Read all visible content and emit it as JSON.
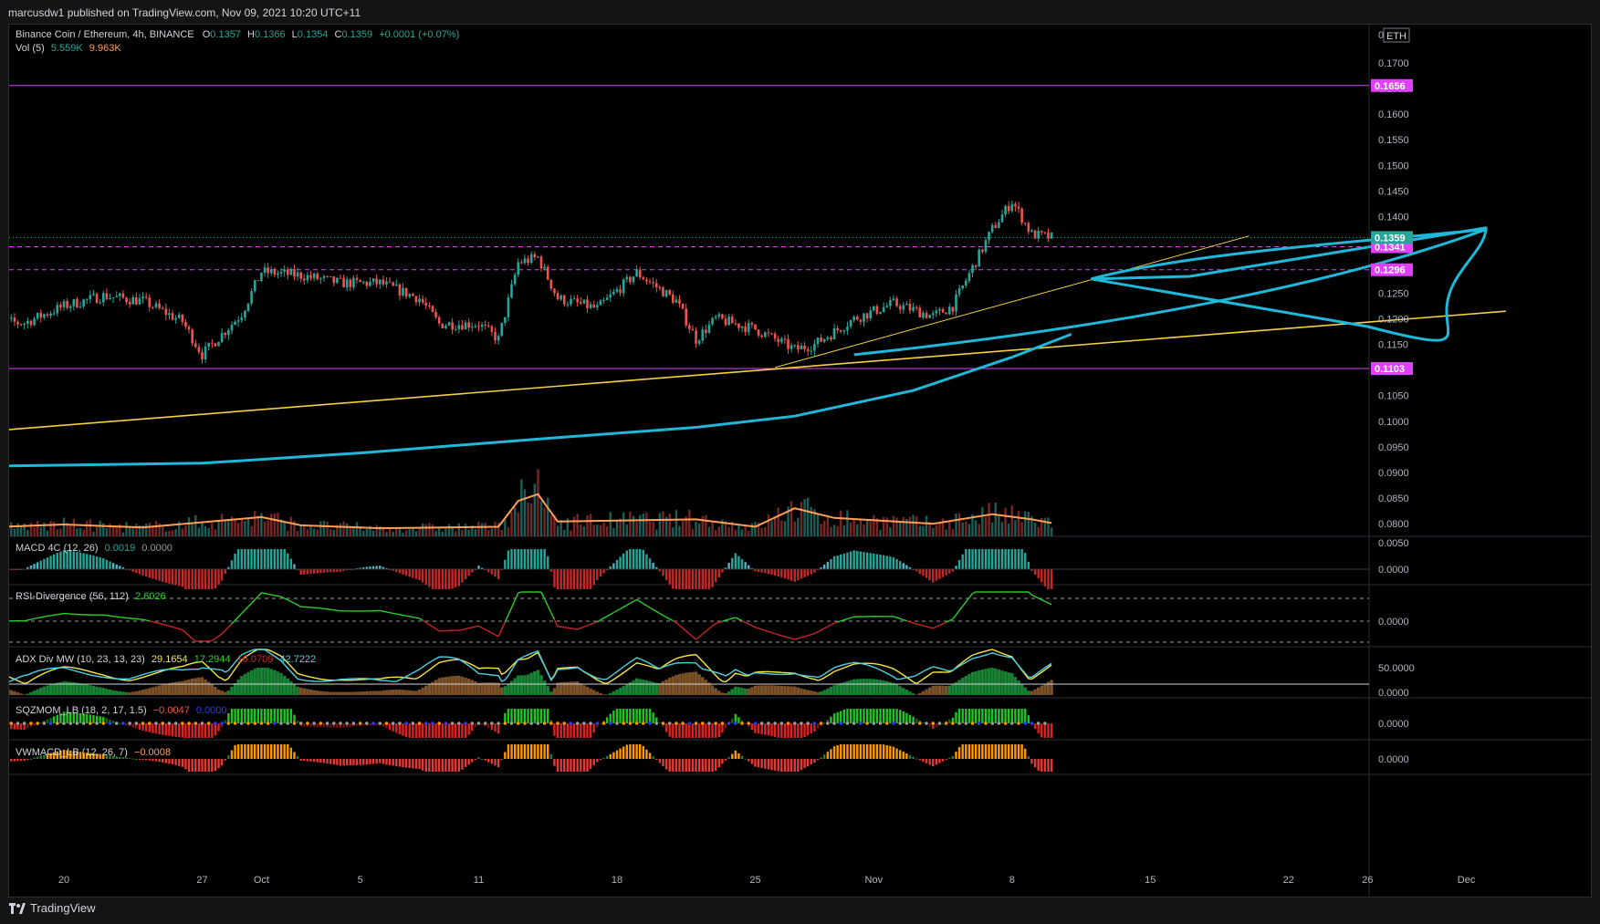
{
  "header": {
    "published": "marcusdw1 published on TradingView.com, Nov 09, 2021 10:20 UTC+11",
    "brand": "TradingView"
  },
  "legend": {
    "symbol": "Binance Coin / Ethereum, 4h, BINANCE",
    "o_label": "O",
    "o": "0.1357",
    "h_label": "H",
    "h": "0.1366",
    "l_label": "L",
    "l": "0.1354",
    "c_label": "C",
    "c": "0.1359",
    "change": "+0.0001 (+0.07%)",
    "vol_label": "Vol (5)",
    "vol1": "5.559K",
    "vol2": "9.963K"
  },
  "currency": "ETH",
  "colors": {
    "up": "#26a69a",
    "down": "#ef5350",
    "purple": "#e040fb",
    "yellow": "#f5d142",
    "cyan": "#1fb8d8",
    "orange": "#ff9f57",
    "green": "#2bd12b",
    "red": "#c62828",
    "price_tag": "#26a69a"
  },
  "chart_data": [
    {
      "type": "candlestick",
      "title": "Binance Coin / Ethereum, 4h, BINANCE",
      "ylim": [
        0.0775,
        0.1775
      ],
      "y_ticks": [
        "0.1700",
        "0.1650",
        "0.1600",
        "0.1550",
        "0.1500",
        "0.1450",
        "0.1400",
        "0.1350",
        "0.1300",
        "0.1250",
        "0.1200",
        "0.1150",
        "0.1100",
        "0.1050",
        "0.1000",
        "0.0950",
        "0.0900",
        "0.0850",
        "0.0800"
      ],
      "top_tick": "0",
      "x_ticks": [
        "20",
        "27",
        "Oct",
        "5",
        "11",
        "18",
        "25",
        "Nov",
        "8",
        "15",
        "22",
        "26",
        "Dec"
      ],
      "close_path": [
        [
          "Sep 16",
          0.1195
        ],
        [
          "Sep 18",
          0.1192
        ],
        [
          "Sep 20",
          0.1225
        ],
        [
          "Sep 22",
          0.1245
        ],
        [
          "Sep 24",
          0.1235
        ],
        [
          "Sep 26",
          0.1195
        ],
        [
          "Sep 27",
          0.113
        ],
        [
          "Sep 29",
          0.121
        ],
        [
          "Sep 30",
          0.1292
        ],
        [
          "Oct 2",
          0.1285
        ],
        [
          "Oct 4",
          0.127
        ],
        [
          "Oct 6",
          0.127
        ],
        [
          "Oct 8",
          0.124
        ],
        [
          "Oct 9",
          0.119
        ],
        [
          "Oct 11",
          0.119
        ],
        [
          "Oct 12",
          0.116
        ],
        [
          "Oct 13",
          0.131
        ],
        [
          "Oct 14",
          0.132
        ],
        [
          "Oct 15",
          0.124
        ],
        [
          "Oct 17",
          0.122
        ],
        [
          "Oct 19",
          0.129
        ],
        [
          "Oct 21",
          0.1235
        ],
        [
          "Oct 22",
          0.116
        ],
        [
          "Oct 23",
          0.12
        ],
        [
          "Oct 25",
          0.118
        ],
        [
          "Oct 27",
          0.114
        ],
        [
          "Oct 28",
          0.115
        ],
        [
          "Oct 30",
          0.12
        ],
        [
          "Nov 1",
          0.123
        ],
        [
          "Nov 3",
          0.1205
        ],
        [
          "Nov 4",
          0.1225
        ],
        [
          "Nov 6",
          0.1375
        ],
        [
          "Nov 7",
          0.143
        ],
        [
          "Nov 8",
          0.1365
        ],
        [
          "Nov 9",
          0.1359
        ]
      ],
      "last_price": "0.1359",
      "levels": [
        {
          "value": 0.1656,
          "label": "0.1656",
          "style": "solid",
          "color": "#e040fb"
        },
        {
          "value": 0.1341,
          "label": "0.1341",
          "style": "dashed",
          "color": "#e040fb"
        },
        {
          "value": 0.1296,
          "label": "0.1296",
          "style": "dashed",
          "color": "#e040fb"
        },
        {
          "value": 0.1103,
          "label": "0.1103",
          "style": "solid",
          "color": "#e040fb"
        }
      ],
      "trendlines": [
        {
          "from": [
            "Sep 16",
            0.098
          ],
          "to": [
            "Dec 2",
            0.1215
          ],
          "color": "#f5d142"
        },
        {
          "from": [
            "Oct 26",
            0.1105
          ],
          "to": [
            "Nov 19",
            0.1362
          ],
          "color": "#f5d142"
        }
      ],
      "moving_average": [
        [
          "Sep 16",
          0.0912
        ],
        [
          "Sep 27",
          0.0918
        ],
        [
          "Oct 5",
          0.0938
        ],
        [
          "Oct 14",
          0.0965
        ],
        [
          "Oct 22",
          0.0988
        ],
        [
          "Oct 27",
          0.101
        ],
        [
          "Nov 2",
          0.106
        ],
        [
          "Nov 7",
          0.1125
        ],
        [
          "Nov 10",
          0.117
        ]
      ],
      "volume_ylim": [
        0,
        10
      ],
      "volume_ma": [
        [
          "Sep 16",
          1.2
        ],
        [
          "Sep 20",
          1.6
        ],
        [
          "Sep 24",
          1.2
        ],
        [
          "Sep 30",
          2.6
        ],
        [
          "Oct 2",
          1.5
        ],
        [
          "Oct 6",
          1.1
        ],
        [
          "Oct 12",
          1.3
        ],
        [
          "Oct 13",
          4.8
        ],
        [
          "Oct 14",
          5.7
        ],
        [
          "Oct 15",
          2.0
        ],
        [
          "Oct 22",
          2.3
        ],
        [
          "Oct 25",
          1.3
        ],
        [
          "Oct 27",
          3.8
        ],
        [
          "Oct 29",
          2.5
        ],
        [
          "Nov 3",
          1.7
        ],
        [
          "Nov 6",
          3.0
        ],
        [
          "Nov 8",
          2.3
        ],
        [
          "Nov 9",
          1.8
        ]
      ]
    }
  ],
  "panels": [
    {
      "name": "MACD 4C",
      "params": "(12, 26)",
      "v1": "0.0019",
      "v2": "0.0000",
      "ticks": [
        "0.0050",
        "0.0000"
      ]
    },
    {
      "name": "RSI-Divergence",
      "params": "(56, 112)",
      "v1": "2.6026",
      "ticks": [
        "0.0000"
      ]
    },
    {
      "name": "ADX Div MW",
      "params": "(10, 23, 13, 23)",
      "v1": "29.1654",
      "v2": "17.2944",
      "v3": "16.0709",
      "v4": "42.7222",
      "ticks": [
        "50.0000",
        "0.0000"
      ]
    },
    {
      "name": "SQZMOM_LB",
      "params": "(18, 2, 17, 1.5)",
      "v1": "−0.0047",
      "v2": "0.0000",
      "ticks": [
        "0.0000"
      ]
    },
    {
      "name": "VWMACD_LB",
      "params": "(12, 26, 7)",
      "v1": "−0.0008",
      "ticks": [
        "0.0000"
      ]
    }
  ]
}
